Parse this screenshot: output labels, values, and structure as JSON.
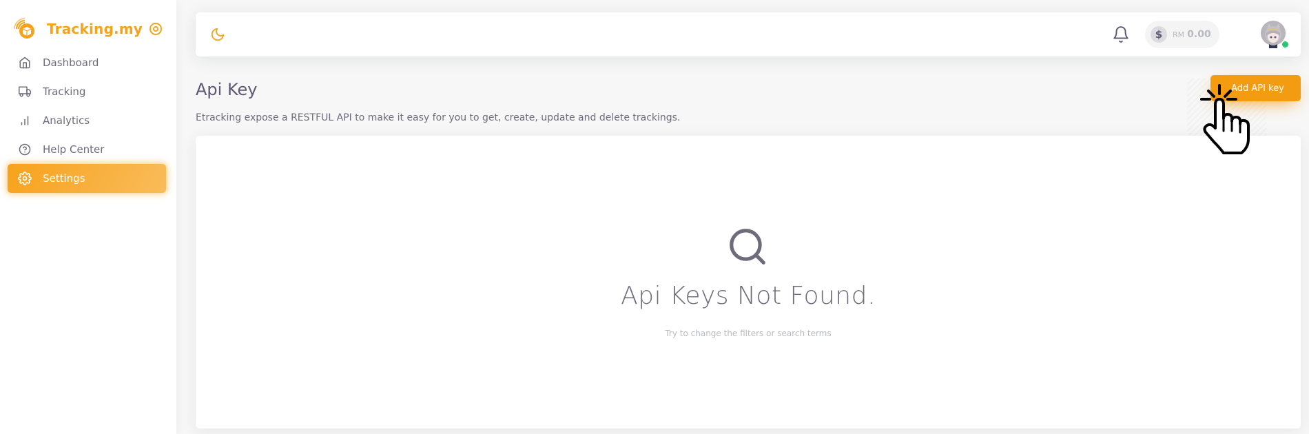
{
  "brand": {
    "name": "Tracking.my",
    "accent_color": "#f7a21b",
    "logo_icon": "parcel-radar-logo",
    "toggle_icon": "circle-dot-icon"
  },
  "sidebar": {
    "items": [
      {
        "label": "Dashboard",
        "icon": "home-icon",
        "active": false
      },
      {
        "label": "Tracking",
        "icon": "truck-icon",
        "active": false
      },
      {
        "label": "Analytics",
        "icon": "bar-chart-icon",
        "active": false
      },
      {
        "label": "Help Center",
        "icon": "help-circle-icon",
        "active": false
      },
      {
        "label": "Settings",
        "icon": "settings-icon",
        "active": true
      }
    ]
  },
  "navbar": {
    "theme_icon": "moon-icon",
    "notification_icon": "bell-icon",
    "wallet": {
      "icon": "dollar-icon",
      "coin_symbol": "$",
      "currency": "RM",
      "balance": "0.00"
    },
    "avatar": {
      "status": "online",
      "status_color": "#28c76f"
    }
  },
  "page": {
    "title": "Api Key",
    "description": "Etracking expose a RESTFUL API to make it easy for you to get, create, update and delete trackings.",
    "add_button_label": "Add API key",
    "button_color": "#f39c12"
  },
  "empty_state": {
    "icon": "search-icon",
    "title": "Api Keys Not Found.",
    "subtitle": "Try to change the filters or search terms"
  }
}
